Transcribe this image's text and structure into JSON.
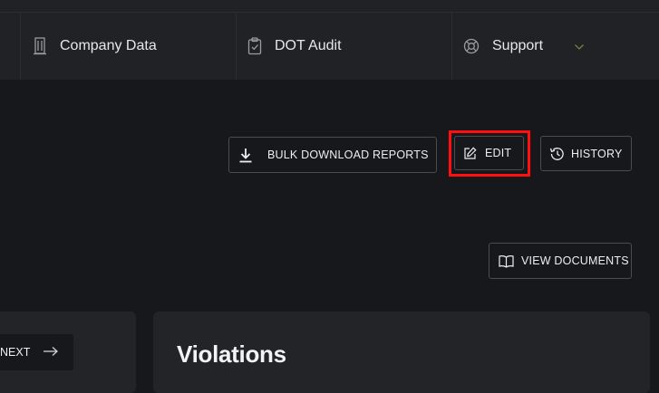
{
  "nav": {
    "items": [
      {
        "label": "Company Data",
        "icon": "building-icon"
      },
      {
        "label": "DOT Audit",
        "icon": "clipboard-check-icon"
      },
      {
        "label": "Support",
        "icon": "lifebuoy-icon"
      }
    ]
  },
  "toolbar": {
    "bulk_download_label": "BULK DOWNLOAD REPORTS",
    "edit_label": "EDIT",
    "history_label": "HISTORY",
    "view_documents_label": "VIEW DOCUMENTS"
  },
  "pager": {
    "next_label": "NEXT"
  },
  "violations": {
    "title": "Violations"
  },
  "colors": {
    "background": "#17181c",
    "navbar": "#202226",
    "card": "#222428",
    "highlight": "#ff1010",
    "chevron": "#6a8a3a"
  }
}
